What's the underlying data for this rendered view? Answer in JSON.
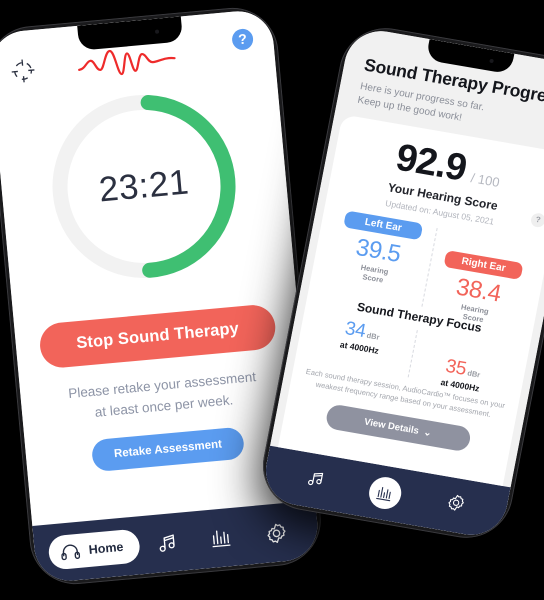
{
  "app": {
    "accent_red": "#F2645A",
    "accent_blue": "#5B9CF0",
    "accent_green": "#3FBF72",
    "nav_navy": "#262F4E",
    "brand": "AudioCardio"
  },
  "left_phone": {
    "header": {
      "target_icon": "crosshair-target-icon",
      "logo_icon": "heartbeat-waveform-logo",
      "help_label": "?"
    },
    "timer": {
      "value": "23:21",
      "progress_percent": 48,
      "track_color": "#F1F1F1",
      "progress_color": "#3FBF72"
    },
    "stop_button": "Stop Sound Therapy",
    "note_line1": "Please retake your assessment",
    "note_line2": "at least once per week.",
    "retake_button": "Retake Assessment",
    "navbar": {
      "items": [
        {
          "label": "Home",
          "icon": "headphones-icon",
          "active": true
        },
        {
          "label": "",
          "icon": "music-note-icon",
          "active": false
        },
        {
          "label": "",
          "icon": "equalizer-icon",
          "active": false
        },
        {
          "label": "",
          "icon": "gear-icon",
          "active": false
        }
      ]
    }
  },
  "right_phone": {
    "title": "Sound Therapy Progress",
    "subtitle_line1": "Here is your progress so far.",
    "subtitle_line2": "Keep up the good work!",
    "score": {
      "value": "92.9",
      "out_of": "/ 100",
      "caption": "Your Hearing Score",
      "updated": "Updated on: August 05, 2021",
      "help_label": "?"
    },
    "ears": [
      {
        "pill": "Left Ear",
        "value": "39.5",
        "label_line1": "Hearing",
        "label_line2": "Score",
        "color": "#5B9CF0"
      },
      {
        "pill": "Right Ear",
        "value": "38.4",
        "label_line1": "Hearing",
        "label_line2": "Score",
        "color": "#F2645A"
      }
    ],
    "focus": {
      "title": "Sound Therapy Focus",
      "entries": [
        {
          "value": "34",
          "unit": "dBr",
          "freq": "at 4000Hz",
          "color": "#5B9CF0"
        },
        {
          "value": "35",
          "unit": "dBr",
          "freq": "at 4000Hz",
          "color": "#F2645A"
        }
      ]
    },
    "disclaimer": "Each sound therapy session, AudioCardio™ focuses on your weakest frequency range based on your assessment.",
    "view_details_button": "View Details",
    "view_details_chevron": "⌄",
    "navbar": {
      "items": [
        {
          "icon": "music-note-icon",
          "active": false
        },
        {
          "icon": "equalizer-icon",
          "active": true
        },
        {
          "icon": "gear-icon",
          "active": false
        }
      ]
    }
  }
}
